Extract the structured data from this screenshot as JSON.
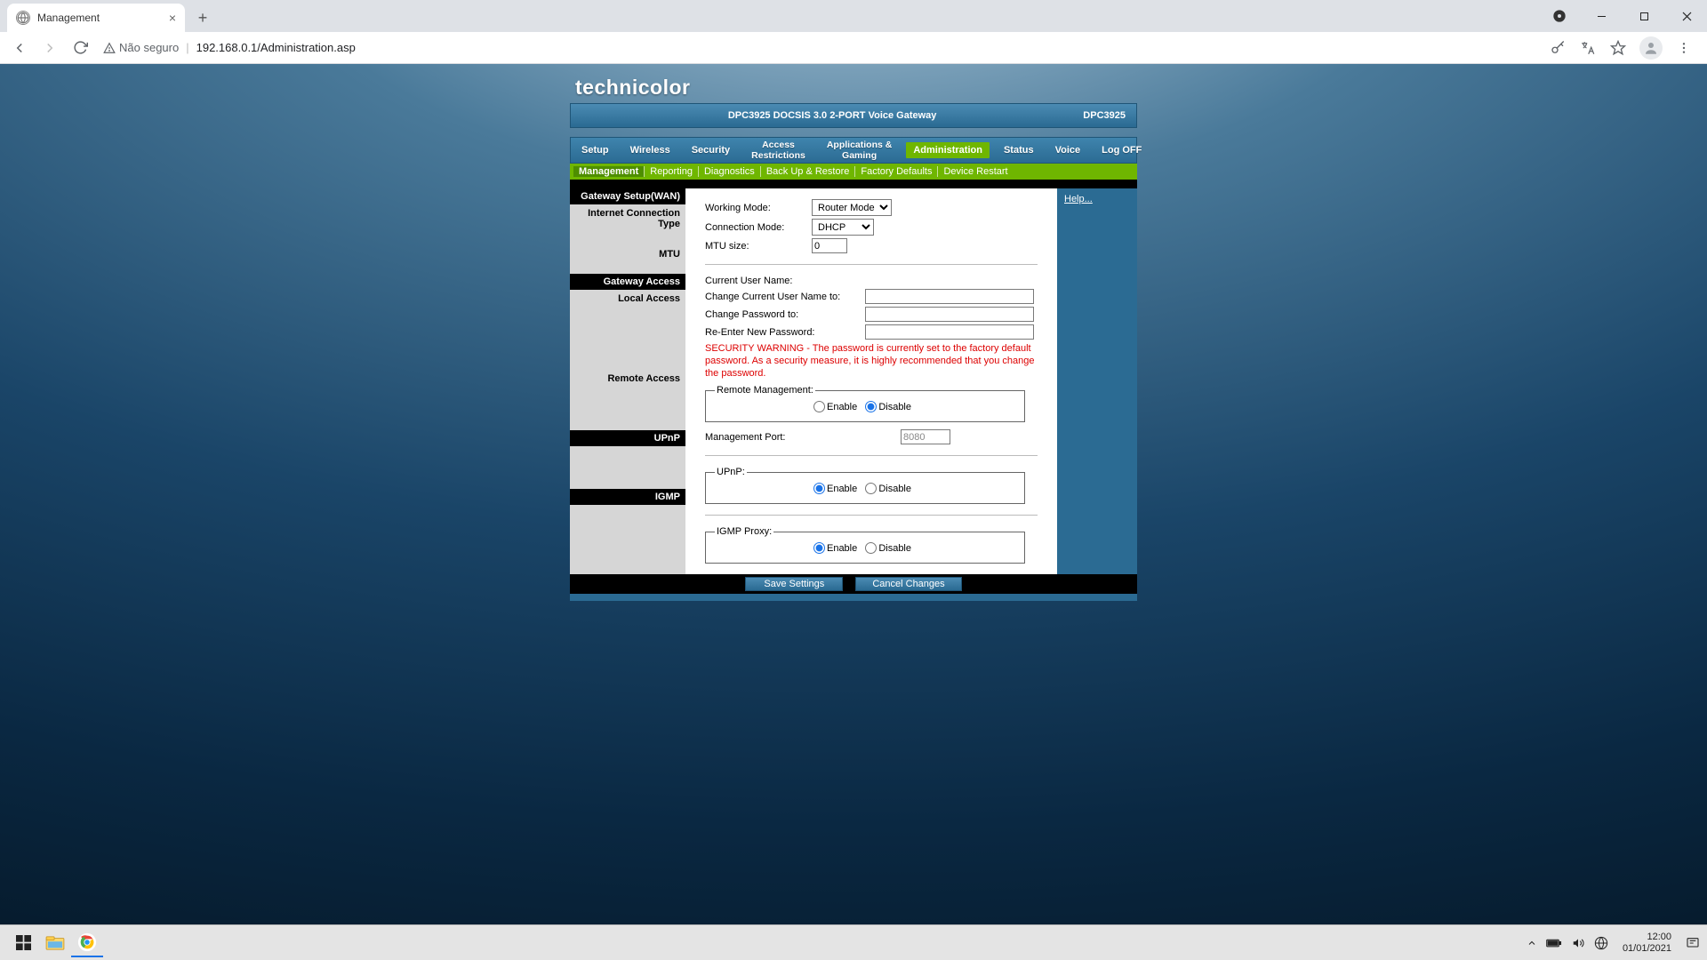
{
  "browser": {
    "tab_title": "Management",
    "security_label": "Não seguro",
    "url": "192.168.0.1/Administration.asp"
  },
  "brand": "technicolor",
  "model_bar": {
    "name": "DPC3925 DOCSIS 3.0 2-PORT Voice Gateway",
    "code": "DPC3925"
  },
  "main_nav": [
    "Setup",
    "Wireless",
    "Security",
    "Access Restrictions",
    "Applications & Gaming",
    "Administration",
    "Status",
    "Voice",
    "Log OFF"
  ],
  "main_nav_active": "Administration",
  "sub_nav": [
    "Management",
    "Reporting",
    "Diagnostics",
    "Back Up & Restore",
    "Factory Defaults",
    "Device Restart"
  ],
  "sub_nav_active": "Management",
  "help_label": "Help...",
  "sidebar": {
    "gateway_setup": "Gateway Setup(WAN)",
    "ict": "Internet Connection Type",
    "mtu": "MTU",
    "gateway_access": "Gateway Access",
    "local_access": "Local Access",
    "remote_access": "Remote Access",
    "upnp": "UPnP",
    "igmp": "IGMP"
  },
  "form": {
    "working_mode_label": "Working Mode:",
    "working_mode_value": "Router Mode",
    "connection_mode_label": "Connection Mode:",
    "connection_mode_value": "DHCP",
    "mtu_size_label": "MTU size:",
    "mtu_size_value": "0",
    "current_user_label": "Current User Name:",
    "change_user_label": "Change Current User Name to:",
    "change_pw_label": "Change Password to:",
    "reenter_pw_label": "Re-Enter New Password:",
    "security_warning": "SECURITY WARNING - The password is currently set to the factory default password. As a security measure, it is highly recommended that you change the password.",
    "remote_mgmt_legend": "Remote Management:",
    "mgmt_port_label": "Management Port:",
    "mgmt_port_value": "8080",
    "upnp_legend": "UPnP:",
    "igmp_legend": "IGMP Proxy:",
    "enable": "Enable",
    "disable": "Disable"
  },
  "footer": {
    "save": "Save  Settings",
    "cancel": "Cancel Changes"
  },
  "taskbar": {
    "time": "12:00",
    "date": "01/01/2021"
  }
}
